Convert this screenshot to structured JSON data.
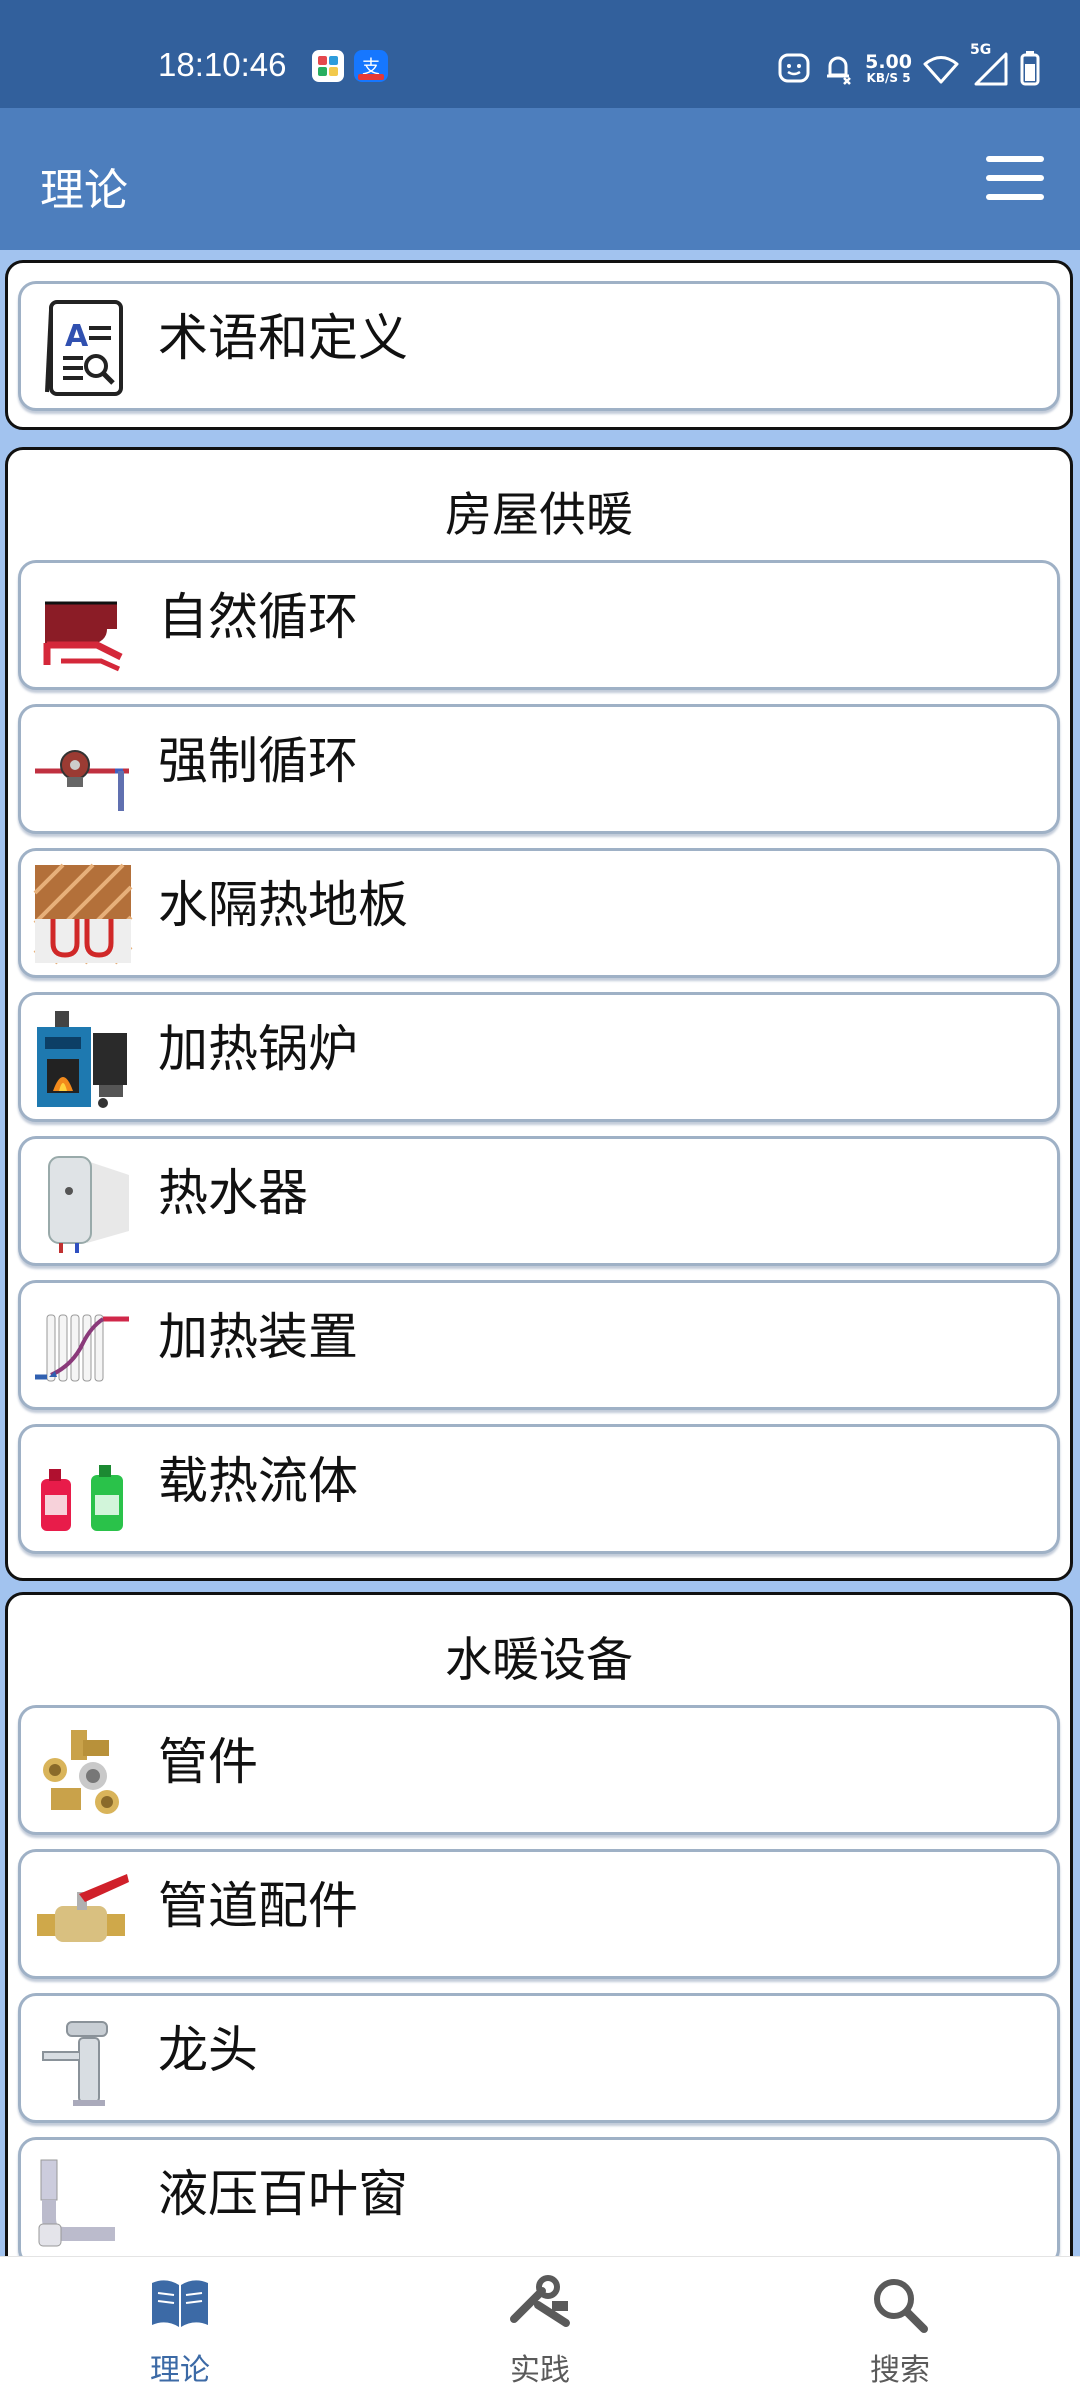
{
  "status_bar": {
    "time": "18:10:46",
    "net_speed_value": "5.00",
    "net_speed_unit": "KB/S",
    "net_speed_count": "5",
    "network": "5G",
    "icons": [
      "app-grid-icon",
      "alipay-icon",
      "face-icon",
      "bell-off-icon",
      "wifi-icon",
      "signal-icon",
      "battery-icon"
    ]
  },
  "app_bar": {
    "title": "理论",
    "menu_icon": "hamburger-icon"
  },
  "sections": [
    {
      "title": "",
      "items": [
        {
          "label": "术语和定义",
          "icon": "glossary-book-icon"
        }
      ]
    },
    {
      "title": "房屋供暖",
      "items": [
        {
          "label": "自然循环",
          "icon": "natural-circulation-icon"
        },
        {
          "label": "强制循环",
          "icon": "circulation-pump-icon"
        },
        {
          "label": "水隔热地板",
          "icon": "underfloor-heating-icon"
        },
        {
          "label": "加热锅炉",
          "icon": "boiler-icon"
        },
        {
          "label": "热水器",
          "icon": "water-heater-icon"
        },
        {
          "label": "加热装置",
          "icon": "radiator-icon"
        },
        {
          "label": "载热流体",
          "icon": "coolant-bottles-icon"
        }
      ]
    },
    {
      "title": "水暖设备",
      "items": [
        {
          "label": "管件",
          "icon": "pipe-fittings-icon"
        },
        {
          "label": "管道配件",
          "icon": "ball-valve-icon"
        },
        {
          "label": "龙头",
          "icon": "faucet-icon"
        },
        {
          "label": "液压百叶窗",
          "icon": "siphon-trap-icon"
        }
      ]
    }
  ],
  "bottom_nav": [
    {
      "label": "理论",
      "icon": "book-icon",
      "active": true
    },
    {
      "label": "实践",
      "icon": "tools-icon",
      "active": false
    },
    {
      "label": "搜索",
      "icon": "search-icon",
      "active": false
    }
  ],
  "colors": {
    "status_bar": "#32609c",
    "app_bar": "#4d7ebd",
    "content_bg": "#a2c3ef",
    "active_nav": "#3c6aa6",
    "inactive_nav": "#5a5a5a"
  }
}
